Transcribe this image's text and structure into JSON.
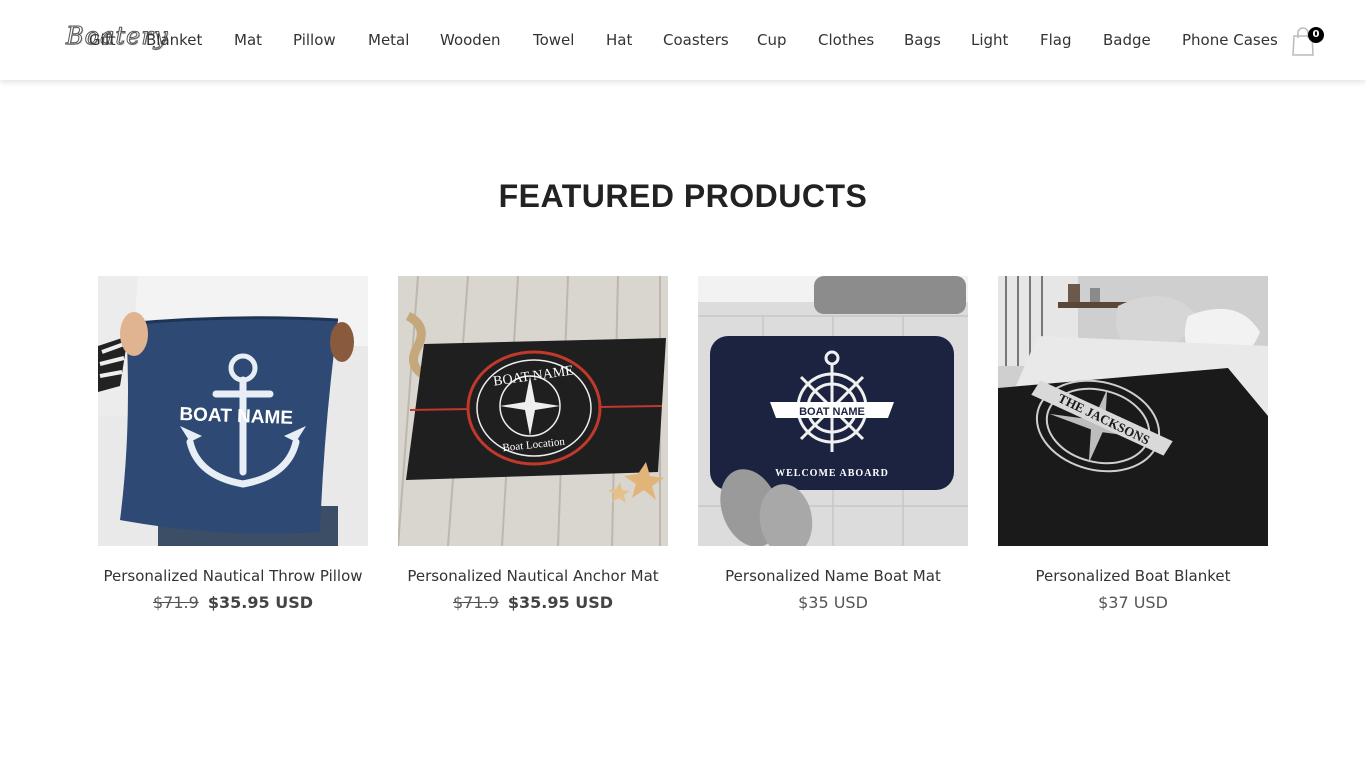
{
  "header": {
    "logo_text": "Boatery",
    "nav": [
      "Gift",
      "Blanket",
      "Mat",
      "Pillow",
      "Metal",
      "Wooden",
      "Towel",
      "Hat",
      "Coasters",
      "Cup",
      "Clothes",
      "Bags",
      "Light",
      "Flag",
      "Badge",
      "Phone Cases"
    ],
    "cart_count": "0",
    "cart_icon": "shopping-bag-icon"
  },
  "section": {
    "title": "FEATURED PRODUCTS"
  },
  "products": [
    {
      "title": "Personalized Nautical Throw Pillow",
      "old_price": "$71.9",
      "price": "$35.95 USD",
      "image_text": "BOAT NAME"
    },
    {
      "title": "Personalized Nautical Anchor Mat",
      "old_price": "$71.9",
      "price": "$35.95 USD",
      "image_text": "BOAT NAME",
      "image_subtext": "Boat Location"
    },
    {
      "title": "Personalized Name Boat Mat",
      "price": "$35 USD",
      "image_text": "BOAT NAME",
      "image_subtext": "WELCOME ABOARD"
    },
    {
      "title": "Personalized Boat Blanket",
      "price": "$37 USD",
      "image_text": "THE JACKSONS"
    }
  ]
}
